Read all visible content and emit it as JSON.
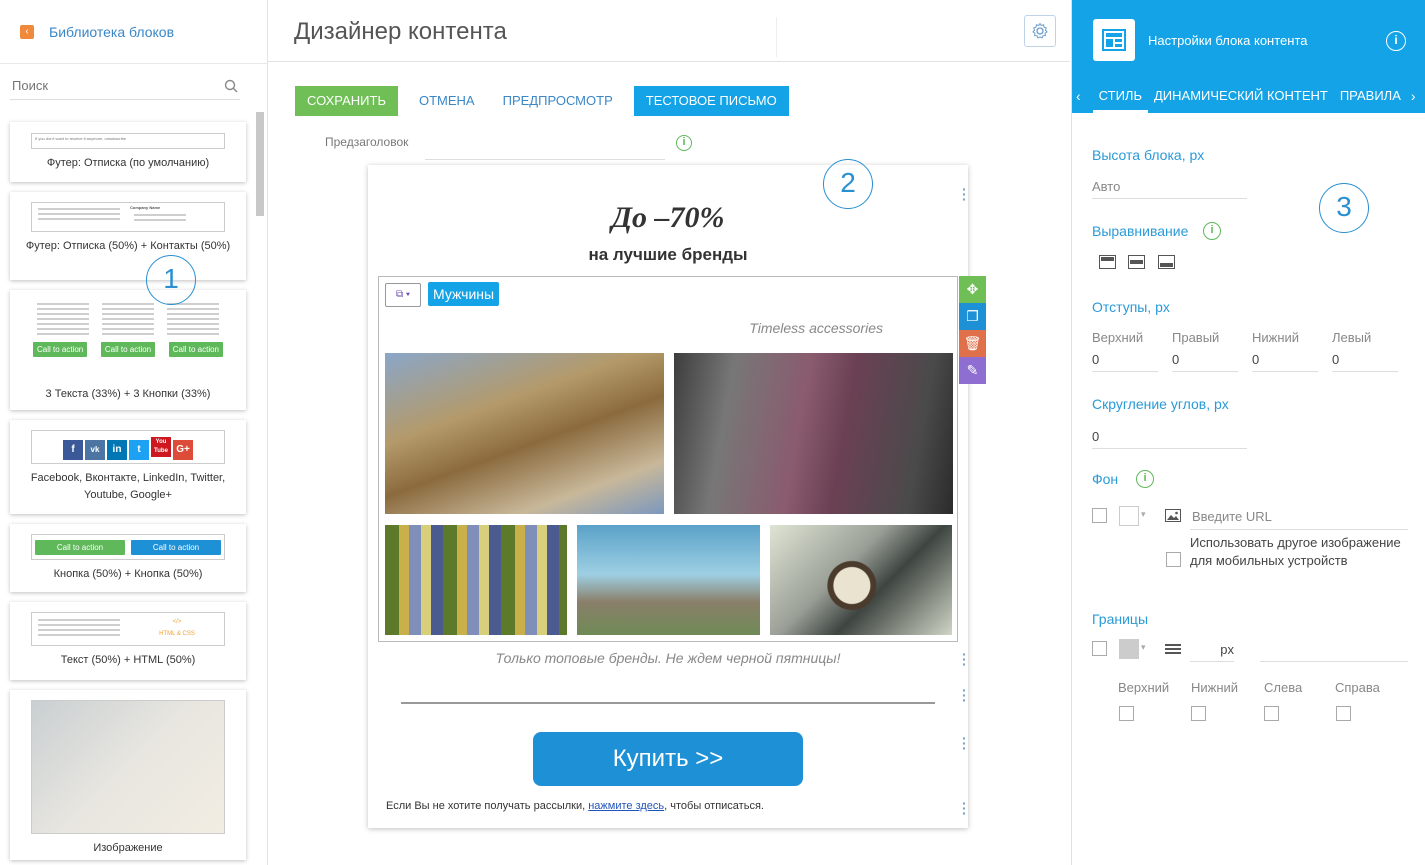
{
  "library": {
    "title": "Библиотека блоков",
    "search_placeholder": "Поиск",
    "cards": [
      {
        "label": "Футер: Отписка (по умолчанию)"
      },
      {
        "label": "Футер: Отписка (50%) + Контакты (50%)"
      },
      {
        "label": "3 Текста (33%) + 3 Кнопки (33%)"
      },
      {
        "label": "Facebook, Вконтакте, LinkedIn, Twitter, Youtube, Google+"
      },
      {
        "label": "Кнопка (50%) + Кнопка (50%)"
      },
      {
        "label": "Текст (50%) + HTML (50%)"
      },
      {
        "label": "Изображение"
      }
    ],
    "thumb_text": {
      "unsub_line": "If you don't want to receive it anymore, unsubscribe",
      "company_name": "Company Name",
      "cta": "Call to action",
      "html_label": "HTML & CSS",
      "html_glyph": "</>"
    },
    "social_icons": [
      "f",
      "vk",
      "in",
      "t",
      "You Tube",
      "G+"
    ]
  },
  "designer": {
    "title": "Дизайнер контента",
    "toolbar": {
      "save": "Сохранить",
      "cancel": "Отмена",
      "preview": "Предпросмотр",
      "test_email": "Тестовое письмо"
    },
    "preheader_label": "Предзаголовок",
    "preheader_value": "",
    "email": {
      "headline": "До –70%",
      "subheadline": "на лучшие бренды",
      "tag": "Мужчины",
      "caption": "Timeless accessories",
      "promo": "Только топовые бренды. Не ждем черной пятницы!",
      "buy_button": "Купить >>",
      "unsubscribe_prefix": "Если Вы не хотите получать рассылки, ",
      "unsubscribe_link": "нажмите здесь",
      "unsubscribe_suffix": ", чтобы отписаться."
    }
  },
  "callouts": [
    "1",
    "2",
    "3"
  ],
  "settings": {
    "title": "Настройки блока контента",
    "tabs": [
      "Стиль",
      "Динамический контент",
      "Правила"
    ],
    "block_height_label": "Высота блока, px",
    "block_height_value": "Авто",
    "alignment_label": "Выравнивание",
    "padding_label": "Отступы, px",
    "padding": [
      {
        "name": "Верхний",
        "value": "0"
      },
      {
        "name": "Правый",
        "value": "0"
      },
      {
        "name": "Нижний",
        "value": "0"
      },
      {
        "name": "Левый",
        "value": "0"
      }
    ],
    "radius_label": "Скругление углов, px",
    "radius_value": "0",
    "background_label": "Фон",
    "url_placeholder": "Введите URL",
    "mobile_image_label": "Использовать другое изображение для мобильных устройств",
    "borders_label": "Границы",
    "border_unit": "px",
    "border_sides": [
      "Верхний",
      "Нижний",
      "Слева",
      "Справа"
    ]
  },
  "colors": {
    "accent": "#13a3e6",
    "save_green": "#6fbf56",
    "link_blue": "#3a87c8",
    "buy_blue": "#1e90d6"
  }
}
